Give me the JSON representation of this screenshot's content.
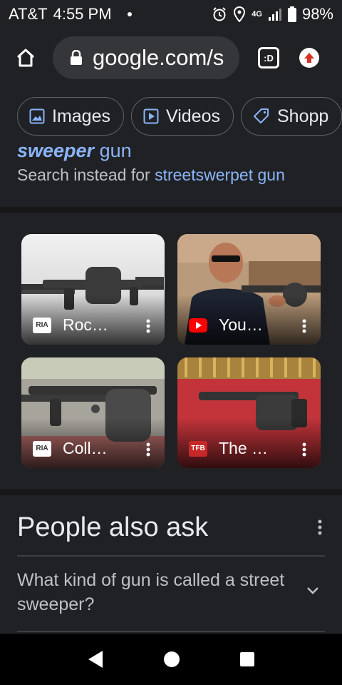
{
  "status_bar": {
    "carrier": "AT&T",
    "time": "4:55 PM",
    "network": "4G",
    "battery": "98%"
  },
  "browser": {
    "url": "google.com/s",
    "tab_label": ":D"
  },
  "chips": [
    {
      "label": "Images"
    },
    {
      "label": "Videos"
    },
    {
      "label": "Shopp"
    }
  ],
  "spell": {
    "corrected_bold": "sweeper",
    "corrected_rest": " gun",
    "instead_prefix": "Search instead for ",
    "instead_link": "streetswerpet gun"
  },
  "images": [
    {
      "source": "Roc…",
      "favicon": "RIA",
      "fav_color": "#ffffff"
    },
    {
      "source": "You…",
      "favicon": "YT",
      "fav_color": "#ff0000"
    },
    {
      "source": "Coll…",
      "favicon": "RIA",
      "fav_color": "#ffffff"
    },
    {
      "source": "The …",
      "favicon": "TFB",
      "fav_color": "#d62b2b"
    }
  ],
  "people_also_ask": {
    "title": "People also ask",
    "questions": [
      {
        "text": "What kind of gun is called a street sweeper?"
      }
    ]
  },
  "colors": {
    "link": "#8ab4f8",
    "background": "#202124"
  }
}
